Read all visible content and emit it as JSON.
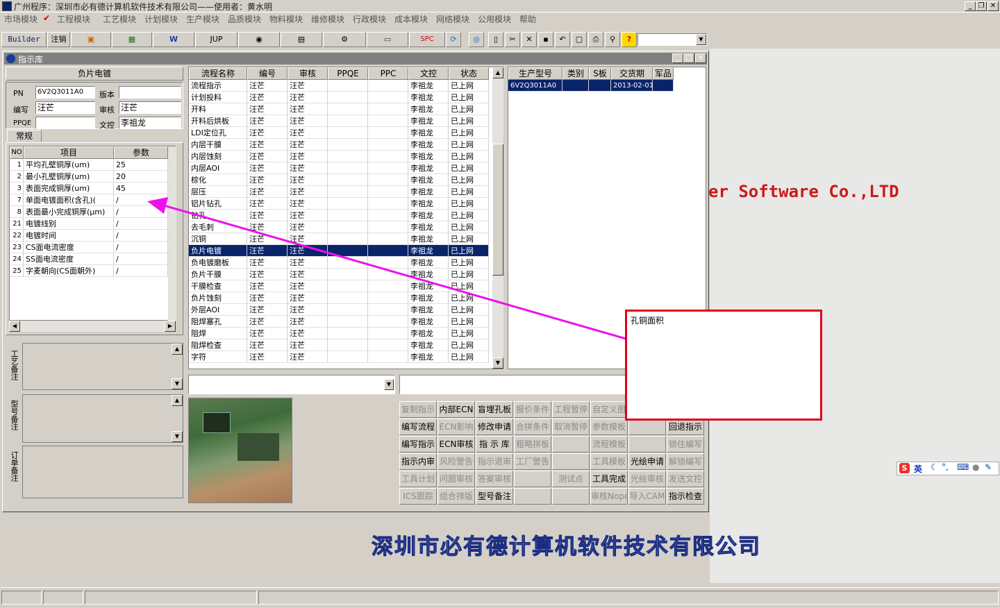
{
  "app_title": "广州程序：深圳市必有德计算机软件技术有限公司——使用者：黄水明",
  "menu": [
    "市场模块",
    "✔",
    "工程模块",
    "工艺模块",
    "计划模块",
    "生产模块",
    "品质模块",
    "物料模块",
    "维修模块",
    "行政模块",
    "成本模块",
    "网络模块",
    "公用模块",
    "帮助"
  ],
  "toolbar": {
    "builder": "Builder",
    "logout": "注销",
    "jup": "JUP",
    "spc": "SPC"
  },
  "bg": {
    "company": "深圳市必有德计算机软件技术有限公司",
    "software": "er Software Co.,LTD"
  },
  "window": {
    "title": "指示库"
  },
  "left": {
    "process_name": "负片电镀",
    "pn_label": "PN",
    "pn": "6V2Q3011A0",
    "version_label": "版本",
    "version": "",
    "author_label": "编写",
    "author": "汪芒",
    "review_label": "审核",
    "review": "汪芒",
    "ppqe_label": "PPQE",
    "ppqe": "",
    "doc_label": "文控",
    "doc": "李祖龙",
    "tab": "常规",
    "param_headers": [
      "NO",
      "项目",
      "参数"
    ],
    "params": [
      {
        "no": "1",
        "item": "平均孔壁铜厚(um)",
        "val": "25"
      },
      {
        "no": "2",
        "item": "最小孔壁铜厚(um)",
        "val": "20"
      },
      {
        "no": "3",
        "item": "表面完成铜厚(um)",
        "val": "45"
      },
      {
        "no": "7",
        "item": "单面电镀面积(含孔)(",
        "val": "/"
      },
      {
        "no": "8",
        "item": "表面最小完成铜厚(μm)",
        "val": "/"
      },
      {
        "no": "21",
        "item": "电镀线别",
        "val": "/"
      },
      {
        "no": "22",
        "item": "电镀时间",
        "val": "/"
      },
      {
        "no": "23",
        "item": "CS面电流密度",
        "val": "/"
      },
      {
        "no": "24",
        "item": "SS面电流密度",
        "val": "/"
      },
      {
        "no": "25",
        "item": "字麦朝向(CS面朝外)",
        "val": "/"
      }
    ],
    "note_labels": [
      "工艺备注",
      "型号备注",
      "订单备注"
    ]
  },
  "flow": {
    "headers": [
      "流程名称",
      "编号",
      "审核",
      "PPQE",
      "PPC",
      "文控",
      "状态"
    ],
    "rows": [
      [
        "流程指示",
        "汪芒",
        "汪芒",
        "",
        "",
        "李祖龙",
        "已上网"
      ],
      [
        "计划投料",
        "汪芒",
        "汪芒",
        "",
        "",
        "李祖龙",
        "已上网"
      ],
      [
        "开料",
        "汪芒",
        "汪芒",
        "",
        "",
        "李祖龙",
        "已上网"
      ],
      [
        "开料后烘板",
        "汪芒",
        "汪芒",
        "",
        "",
        "李祖龙",
        "已上网"
      ],
      [
        "LDI定位孔",
        "汪芒",
        "汪芒",
        "",
        "",
        "李祖龙",
        "已上网"
      ],
      [
        "内层干膜",
        "汪芒",
        "汪芒",
        "",
        "",
        "李祖龙",
        "已上网"
      ],
      [
        "内层蚀刻",
        "汪芒",
        "汪芒",
        "",
        "",
        "李祖龙",
        "已上网"
      ],
      [
        "内层AOI",
        "汪芒",
        "汪芒",
        "",
        "",
        "李祖龙",
        "已上网"
      ],
      [
        "棕化",
        "汪芒",
        "汪芒",
        "",
        "",
        "李祖龙",
        "已上网"
      ],
      [
        "层压",
        "汪芒",
        "汪芒",
        "",
        "",
        "李祖龙",
        "已上网"
      ],
      [
        "铝片钻孔",
        "汪芒",
        "汪芒",
        "",
        "",
        "李祖龙",
        "已上网"
      ],
      [
        "钻孔",
        "汪芒",
        "汪芒",
        "",
        "",
        "李祖龙",
        "已上网"
      ],
      [
        "去毛刺",
        "汪芒",
        "汪芒",
        "",
        "",
        "李祖龙",
        "已上网"
      ],
      [
        "沉铜",
        "汪芒",
        "汪芒",
        "",
        "",
        "李祖龙",
        "已上网"
      ],
      [
        "负片电镀",
        "汪芒",
        "汪芒",
        "",
        "",
        "李祖龙",
        "已上网"
      ],
      [
        "负电镀磨板",
        "汪芒",
        "汪芒",
        "",
        "",
        "李祖龙",
        "已上网"
      ],
      [
        "负片干膜",
        "汪芒",
        "汪芒",
        "",
        "",
        "李祖龙",
        "已上网"
      ],
      [
        "干膜检查",
        "汪芒",
        "汪芒",
        "",
        "",
        "李祖龙",
        "已上网"
      ],
      [
        "负片蚀刻",
        "汪芒",
        "汪芒",
        "",
        "",
        "李祖龙",
        "已上网"
      ],
      [
        "外层AOI",
        "汪芒",
        "汪芒",
        "",
        "",
        "李祖龙",
        "已上网"
      ],
      [
        "阻焊塞孔",
        "汪芒",
        "汪芒",
        "",
        "",
        "李祖龙",
        "已上网"
      ],
      [
        "阻焊",
        "汪芒",
        "汪芒",
        "",
        "",
        "李祖龙",
        "已上网"
      ],
      [
        "阻焊检查",
        "汪芒",
        "汪芒",
        "",
        "",
        "李祖龙",
        "已上网"
      ],
      [
        "字符",
        "汪芒",
        "汪芒",
        "",
        "",
        "李祖龙",
        "已上网"
      ]
    ],
    "selected_index": 14
  },
  "prod": {
    "headers": [
      "生产型号",
      "类别",
      "S板",
      "交货期",
      "军品"
    ],
    "row": [
      "6V2Q3011A0",
      "",
      "",
      "2013-02-01",
      ""
    ]
  },
  "buttons": [
    [
      {
        "t": "复制指示",
        "d": true
      },
      {
        "t": "内部ECN",
        "d": false
      },
      {
        "t": "盲埋孔板",
        "d": false
      },
      {
        "t": "报价条件",
        "d": true
      },
      {
        "t": "工程暂停",
        "d": true
      },
      {
        "t": "自定义图",
        "d": true
      },
      {
        "t": "",
        "d": true
      },
      {
        "t": "",
        "d": true
      }
    ],
    [
      {
        "t": "编写流程",
        "d": false
      },
      {
        "t": "ECN影响",
        "d": true
      },
      {
        "t": "修改申请",
        "d": false
      },
      {
        "t": "合拼条件",
        "d": true
      },
      {
        "t": "取消暂停",
        "d": true
      },
      {
        "t": "参数模板",
        "d": true
      },
      {
        "t": "",
        "d": true
      },
      {
        "t": "回退指示",
        "d": false
      }
    ],
    [
      {
        "t": "编写指示",
        "d": false
      },
      {
        "t": "ECN审核",
        "d": false
      },
      {
        "t": "指 示 库",
        "d": false
      },
      {
        "t": "粗略拼板",
        "d": true
      },
      {
        "t": "",
        "d": true
      },
      {
        "t": "流程模板",
        "d": true
      },
      {
        "t": "",
        "d": true
      },
      {
        "t": "锁住编写",
        "d": true
      }
    ],
    [
      {
        "t": "指示内审",
        "d": false
      },
      {
        "t": "风险警告",
        "d": true
      },
      {
        "t": "指示退审",
        "d": true
      },
      {
        "t": "工厂警告",
        "d": true
      },
      {
        "t": "",
        "d": true
      },
      {
        "t": "工具模板",
        "d": true
      },
      {
        "t": "光绘申请",
        "d": false
      },
      {
        "t": "解锁编写",
        "d": true
      }
    ],
    [
      {
        "t": "工具计划",
        "d": true
      },
      {
        "t": "问题审核",
        "d": true
      },
      {
        "t": "答案审核",
        "d": true
      },
      {
        "t": "",
        "d": true
      },
      {
        "t": "测试点",
        "d": true
      },
      {
        "t": "工具完成",
        "d": false
      },
      {
        "t": "光绘审核",
        "d": true
      },
      {
        "t": "发送文控",
        "d": true
      }
    ],
    [
      {
        "t": "ICS跟踪",
        "d": true
      },
      {
        "t": "组合排版",
        "d": true
      },
      {
        "t": "型号备注",
        "d": false
      },
      {
        "t": "",
        "d": true
      },
      {
        "t": "",
        "d": true
      },
      {
        "t": "审核Nope",
        "d": true
      },
      {
        "t": "导入CAM",
        "d": true
      },
      {
        "t": "指示检查",
        "d": false
      }
    ]
  ],
  "popup_text": "孔铜面积",
  "colors": {
    "selection": "#0a246a",
    "arrow": "#ee10ee",
    "popup_border": "#e0001b"
  }
}
